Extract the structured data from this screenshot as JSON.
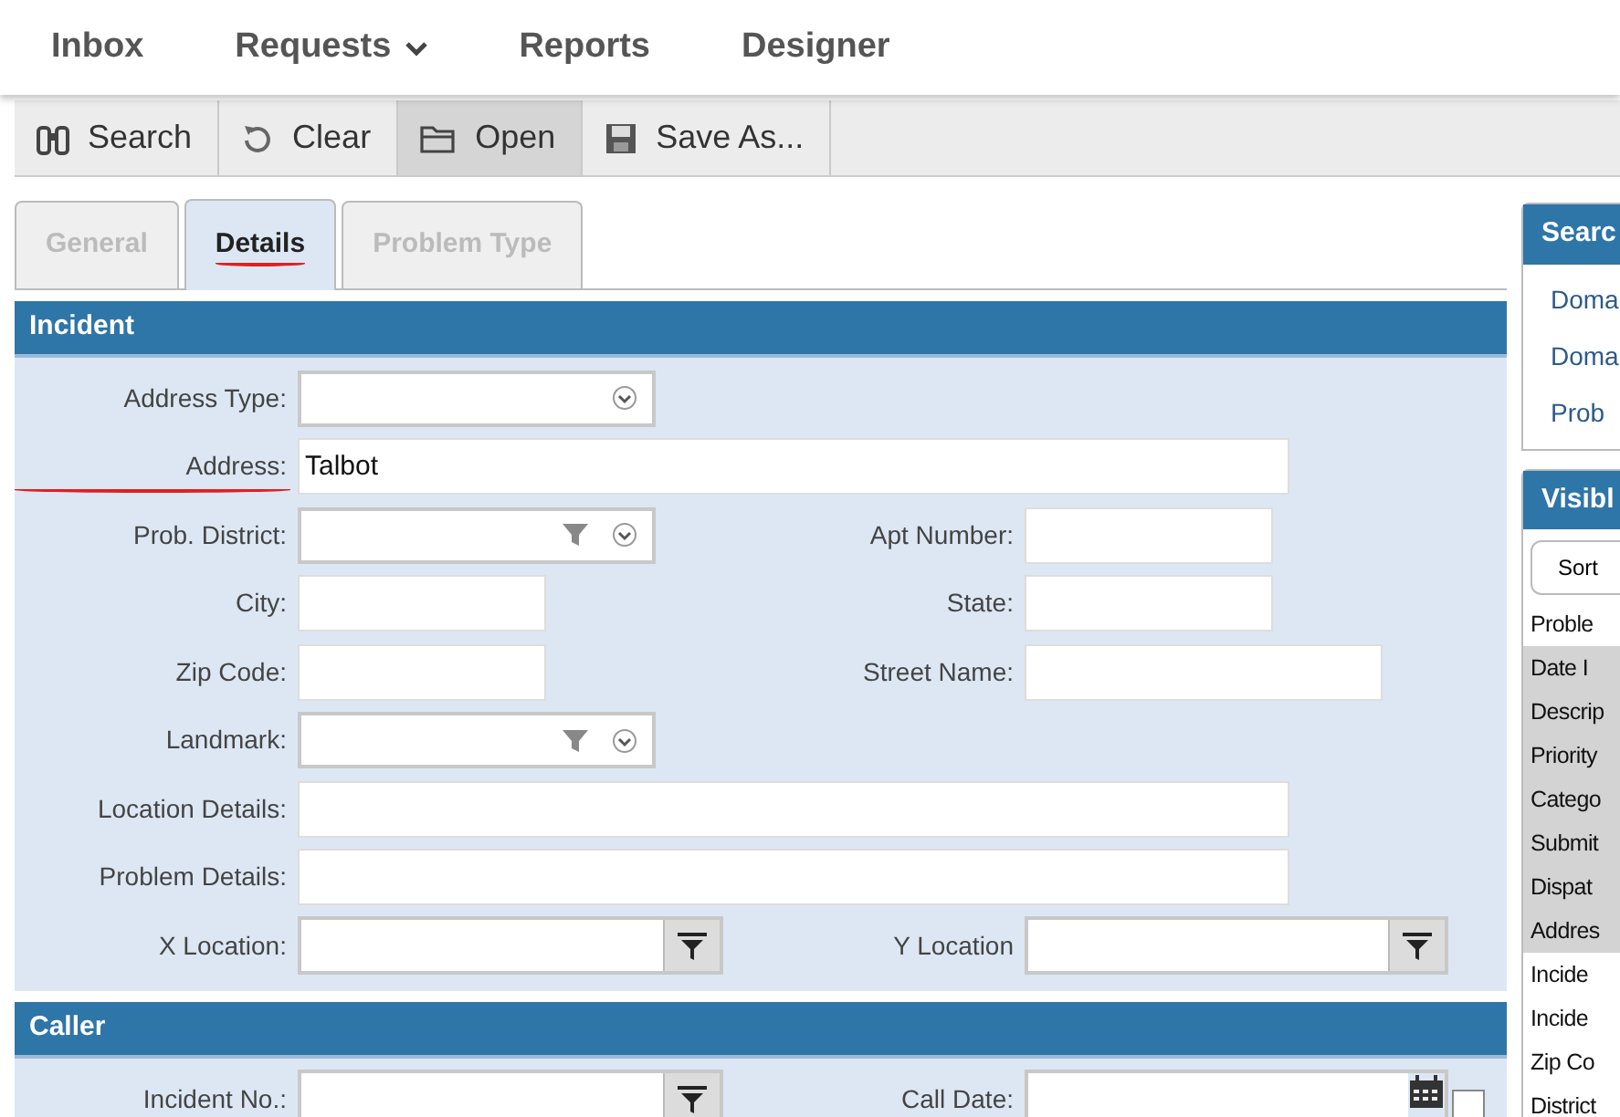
{
  "nav": [
    {
      "label": "Inbox",
      "dropdown": false
    },
    {
      "label": "Requests",
      "dropdown": true
    },
    {
      "label": "Reports",
      "dropdown": false
    },
    {
      "label": "Designer",
      "dropdown": false
    }
  ],
  "toolbar": [
    {
      "label": "Search",
      "active": false
    },
    {
      "label": "Clear",
      "active": false
    },
    {
      "label": "Open",
      "active": true
    },
    {
      "label": "Save As...",
      "active": false
    }
  ],
  "tabs": [
    {
      "label": "General",
      "selected": false,
      "underlined": false
    },
    {
      "label": "Details",
      "selected": true,
      "underlined": true
    },
    {
      "label": "Problem Type",
      "selected": false,
      "underlined": false
    }
  ],
  "sections": [
    {
      "title": "Incident",
      "rows": [
        [
          {
            "label": "Address Type:",
            "kind": "select",
            "underlined": false
          }
        ],
        [
          {
            "label": "Address:",
            "kind": "wide",
            "value": "Talbot",
            "underlined": true
          }
        ],
        [
          {
            "label": "Prob. District:",
            "kind": "select-filter",
            "underlined": false
          },
          {
            "label": "Apt Number:",
            "kind": "text",
            "underlined": false
          }
        ],
        [
          {
            "label": "City:",
            "kind": "text",
            "underlined": false
          },
          {
            "label": "State:",
            "kind": "text",
            "underlined": false
          }
        ],
        [
          {
            "label": "Zip Code:",
            "kind": "text",
            "underlined": false
          },
          {
            "label": "Street Name:",
            "kind": "text",
            "underlined": false
          }
        ],
        [
          {
            "label": "Landmark:",
            "kind": "select-filter",
            "underlined": false
          }
        ],
        [
          {
            "label": "Location Details:",
            "kind": "wide",
            "underlined": false
          }
        ],
        [
          {
            "label": "Problem Details:",
            "kind": "wide",
            "underlined": false
          }
        ],
        [
          {
            "label": "X Location:",
            "kind": "filter",
            "underlined": false
          },
          {
            "label": "Y Location",
            "kind": "filter",
            "underlined": false
          }
        ]
      ]
    },
    {
      "title": "Caller",
      "rows": [
        [
          {
            "label": "Incident No.:",
            "kind": "filter",
            "underlined": false
          },
          {
            "label": "Call Date:",
            "kind": "date",
            "checked": false,
            "underlined": false
          }
        ]
      ]
    }
  ],
  "side_panel": {
    "search_header": "Searc",
    "search_items": [
      "Doma",
      "Doma",
      "Prob"
    ],
    "visible_header": "Visibl",
    "sort_button": "Sort",
    "columns": [
      {
        "label": "Proble",
        "selected": false
      },
      {
        "label": "Date I",
        "selected": true
      },
      {
        "label": "Descrip",
        "selected": true
      },
      {
        "label": "Priority",
        "selected": true
      },
      {
        "label": "Catego",
        "selected": true
      },
      {
        "label": "Submit",
        "selected": true
      },
      {
        "label": "Dispat",
        "selected": true
      },
      {
        "label": "Addres",
        "selected": true
      },
      {
        "label": "Incide",
        "selected": false
      },
      {
        "label": "Incide",
        "selected": false
      },
      {
        "label": "Zip Co",
        "selected": false
      },
      {
        "label": "District",
        "selected": false
      }
    ]
  }
}
